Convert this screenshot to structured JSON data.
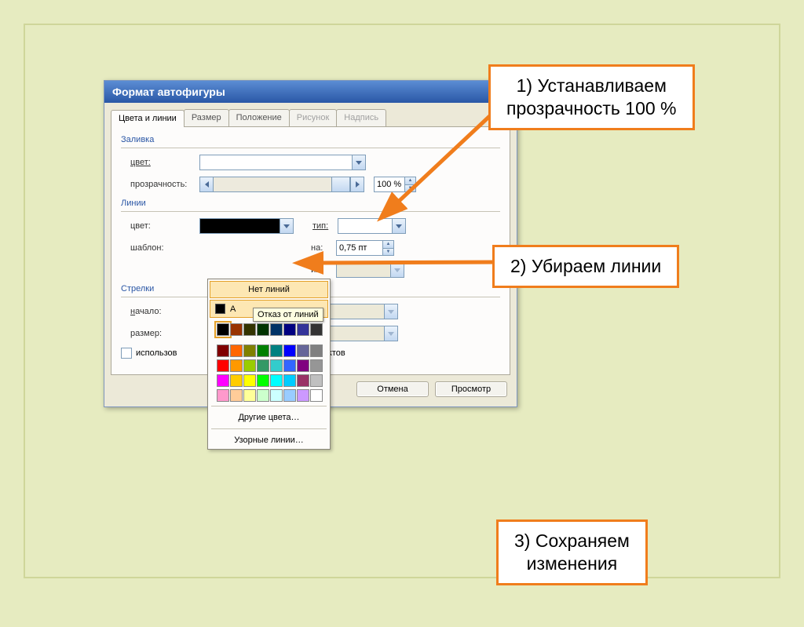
{
  "dialog": {
    "title": "Формат автофигуры",
    "tabs": [
      {
        "label": "Цвета и линии",
        "active": true
      },
      {
        "label": "Размер"
      },
      {
        "label": "Положение"
      },
      {
        "label": "Рисунок",
        "disabled": true
      },
      {
        "label": "Надпись",
        "disabled": true
      }
    ],
    "fill": {
      "group": "Заливка",
      "color_label": "цвет:",
      "transparency_label": "прозрачность:",
      "transparency_value": "100 %"
    },
    "lines": {
      "group": "Линии",
      "color_label": "цвет:",
      "type_label": "тип:",
      "template_label": "шаблон:",
      "width_label": "на:",
      "width_value": "0,75 пт",
      "iya_label": "ия:"
    },
    "arrows": {
      "group": "Стрелки",
      "start_label": "начало:",
      "size_label": "размер:"
    },
    "default_check": "использов",
    "default_tail": "ии объектов",
    "buttons": {
      "cancel": "Отмена",
      "preview": "Просмотр"
    }
  },
  "colorpanel": {
    "no_lines": "Нет линий",
    "auto": "А",
    "tooltip": "Отказ от линий",
    "more": "Другие цвета…",
    "patterns": "Узорные линии…",
    "row1": [
      "#000000",
      "#993300",
      "#333300",
      "#003300",
      "#003366",
      "#000080",
      "#333399",
      "#333333"
    ],
    "rows": [
      [
        "#800000",
        "#ff6600",
        "#808000",
        "#008000",
        "#008080",
        "#0000ff",
        "#666699",
        "#808080"
      ],
      [
        "#ff0000",
        "#ff9900",
        "#99cc00",
        "#339966",
        "#33cccc",
        "#3366ff",
        "#800080",
        "#969696"
      ],
      [
        "#ff00ff",
        "#ffcc00",
        "#ffff00",
        "#00ff00",
        "#00ffff",
        "#00ccff",
        "#993366",
        "#c0c0c0"
      ],
      [
        "#ff99cc",
        "#ffcc99",
        "#ffff99",
        "#ccffcc",
        "#ccffff",
        "#99ccff",
        "#cc99ff",
        "#ffffff"
      ]
    ]
  },
  "callouts": {
    "c1": "1) Устанавливаем\nпрозрачность 100 %",
    "c2": "2) Убираем линии",
    "c3": "3) Сохраняем\nизменения"
  }
}
